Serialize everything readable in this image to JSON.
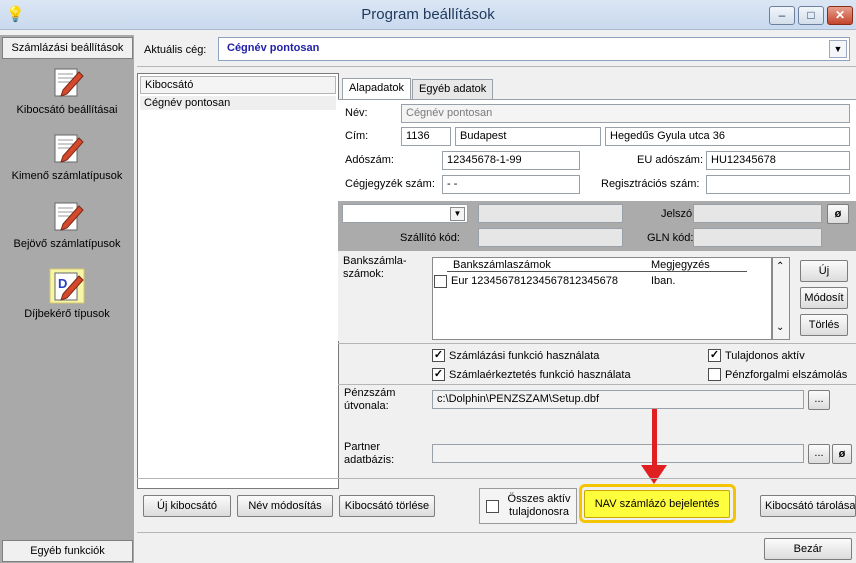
{
  "window": {
    "title": "Program beállítások",
    "minimize": "–",
    "maximize": "□",
    "close": "✕"
  },
  "nav": {
    "top_label": "Számlázási beállítások",
    "items": [
      {
        "label": "Kibocsátó beállításai"
      },
      {
        "label": "Kimenő számlatípusok"
      },
      {
        "label": "Bejövő számlatípusok"
      },
      {
        "label": "Díjbekérő típusok"
      }
    ],
    "bottom_label": "Egyéb funkciók"
  },
  "company": {
    "label": "Aktuális cég:",
    "value": "Cégnév pontosan"
  },
  "issuers": {
    "header": "Kibocsátó",
    "rows": [
      "Cégnév pontosan"
    ]
  },
  "tabs": [
    "Alapadatok",
    "Egyéb adatok"
  ],
  "form": {
    "name_label": "Név:",
    "name_value": "Cégnév pontosan",
    "address_label": "Cím:",
    "zip": "1136",
    "city": "Budapest",
    "street": "Hegedűs Gyula utca 36",
    "tax_label": "Adószám:",
    "tax_value": "12345678-1-99",
    "eu_tax_label": "EU adószám:",
    "eu_tax_value": "HU12345678",
    "reg_label": "Cégjegyzék szám:",
    "reg_value": "- -",
    "regnum_label": "Regisztrációs szám:",
    "regnum_value": "",
    "password_label": "Jelszó:",
    "supplier_code_label": "Szállító kód:",
    "gln_label": "GLN kód:",
    "clear_glyph": "ø"
  },
  "bank": {
    "label": "Bankszámla-\nszámok:",
    "col1": "Bankszámlaszámok",
    "col2": "Megjegyzés",
    "rows": [
      {
        "account": "Eur 123456781234567812345678",
        "note": "Iban."
      }
    ],
    "new_btn": "Új",
    "edit_btn": "Módosít",
    "delete_btn": "Törlés"
  },
  "options": {
    "billing_fn": "Számlázási funkció használata",
    "invoice_arrival_fn": "Számlaérkeztetés funkció használata",
    "owner_active": "Tulajdonos aktív",
    "cash_accounting": "Pénzforgalmi elszámolás"
  },
  "paths": {
    "penzszam_label": "Pénzszám\nútvonala:",
    "penzszam_value": "c:\\Dolphin\\PENZSZAM\\Setup.dbf",
    "partner_label": "Partner\nadatbázis:",
    "partner_value": "",
    "browse": "..."
  },
  "footer": {
    "new_issuer": "Új kibocsátó",
    "rename": "Név módosítás",
    "delete_issuer": "Kibocsátó törlése",
    "all_owners": "Összes aktív\ntulajdonosra",
    "nav_report": "NAV számlázó bejelentés",
    "save_issuer": "Kibocsátó tárolása",
    "close": "Bezár"
  },
  "colors": {
    "highlight": "#f5c400",
    "arrow": "#e02020",
    "company_text": "#1f1fa8"
  }
}
